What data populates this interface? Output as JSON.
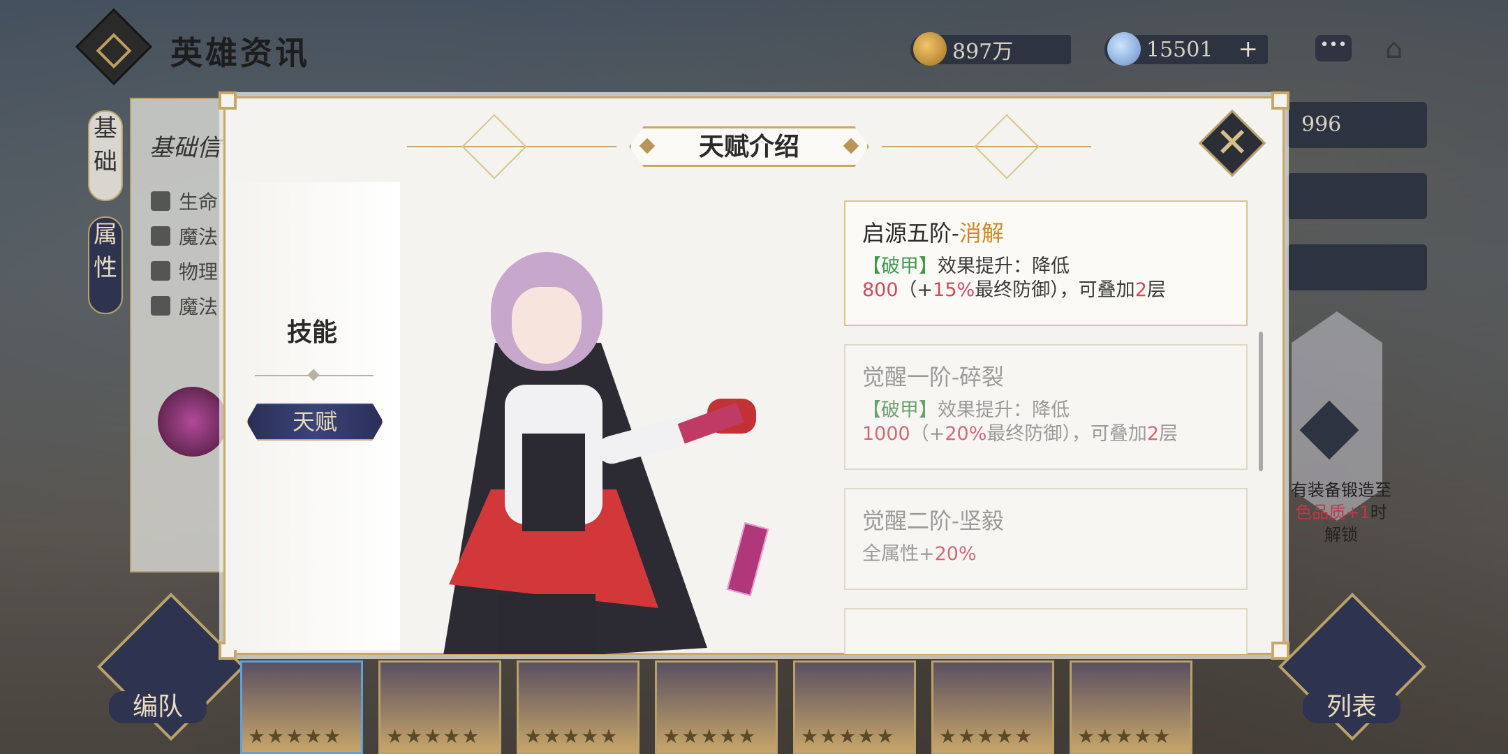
{
  "header": {
    "title": "英雄资讯",
    "gold": "897万",
    "gems": "15501",
    "gem_plus": "+"
  },
  "side_tabs": {
    "basic": "基础",
    "attributes": "属性"
  },
  "basic_panel": {
    "title": "基础信",
    "rows": [
      "生命",
      "魔法",
      "物理",
      "魔法"
    ]
  },
  "right_panel": {
    "power": "996",
    "lock_text_a": "有装备锻造至",
    "lock_text_b": "色品质+1",
    "lock_text_c": "时解锁"
  },
  "bottom": {
    "formation": "编队",
    "list": "列表",
    "stars": "★★★★★"
  },
  "modal": {
    "title": "天赋介绍",
    "skill_label": "技能",
    "talent_tab": "天赋",
    "talents": [
      {
        "stage": "启源五阶-",
        "name": "消解",
        "tag": "【破甲】",
        "desc1": "效果提升：降低",
        "value": "800",
        "paren_open": "（+",
        "percent": "15%",
        "desc2": "最终防御），可叠加",
        "layers": "2",
        "layer_unit": "层"
      },
      {
        "stage": "觉醒一阶-",
        "name": "碎裂",
        "tag": "【破甲】",
        "desc1": "效果提升：降低",
        "value": "1000",
        "paren_open": "（+",
        "percent": "20%",
        "desc2": "最终防御），可叠加",
        "layers": "2",
        "layer_unit": "层"
      },
      {
        "stage": "觉醒二阶-",
        "name": "坚毅",
        "desc": "全属性+",
        "percent": "20%"
      }
    ]
  },
  "colors": {
    "gold_accent": "#c7a866",
    "navy": "#2e3350",
    "highlight_red": "#d04858",
    "highlight_green": "#3a9a4a",
    "talent_name": "#c98a2a"
  }
}
